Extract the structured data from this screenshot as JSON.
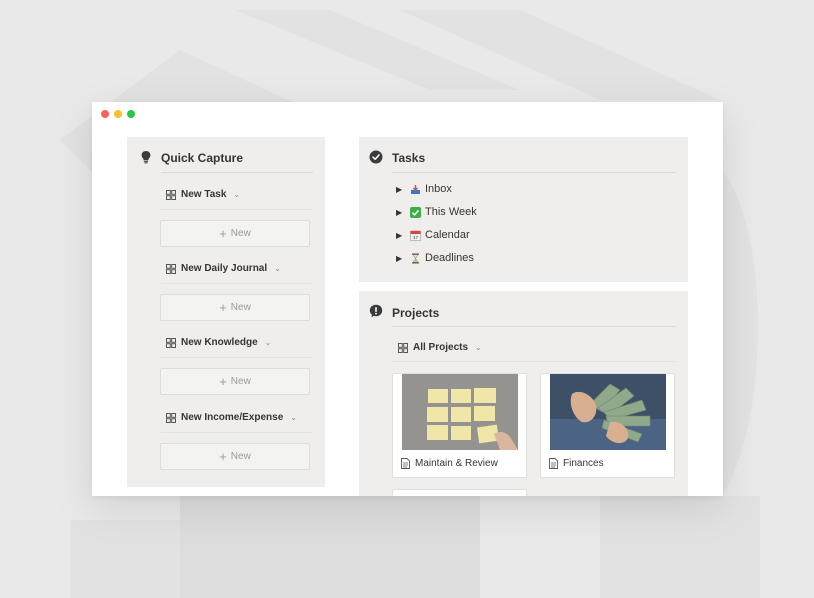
{
  "window": {
    "traffic_lights": [
      "close",
      "minimize",
      "zoom"
    ]
  },
  "quick_capture": {
    "icon": "lightbulb-icon",
    "title": "Quick Capture",
    "databases": [
      {
        "label": "New Task",
        "new_label": "New"
      },
      {
        "label": "New Daily Journal",
        "new_label": "New"
      },
      {
        "label": "New Knowledge",
        "new_label": "New"
      },
      {
        "label": "New Income/Expense",
        "new_label": "New"
      }
    ]
  },
  "tasks": {
    "icon": "check-circle-icon",
    "title": "Tasks",
    "items": [
      {
        "label": "Inbox",
        "icon": "inbox-tray-icon"
      },
      {
        "label": "This Week",
        "icon": "check-mark-button-icon"
      },
      {
        "label": "Calendar",
        "icon": "calendar-icon"
      },
      {
        "label": "Deadlines",
        "icon": "hourglass-icon"
      }
    ]
  },
  "projects": {
    "icon": "exclamation-circle-icon",
    "title": "Projects",
    "view_label": "All Projects",
    "cards": [
      {
        "title": "Maintain & Review",
        "image": "sticky-notes-photo"
      },
      {
        "title": "Finances",
        "image": "cash-money-photo"
      }
    ]
  },
  "colors": {
    "panel_bg": "#efeeec",
    "text": "#37352f",
    "muted": "#9b9a97"
  }
}
